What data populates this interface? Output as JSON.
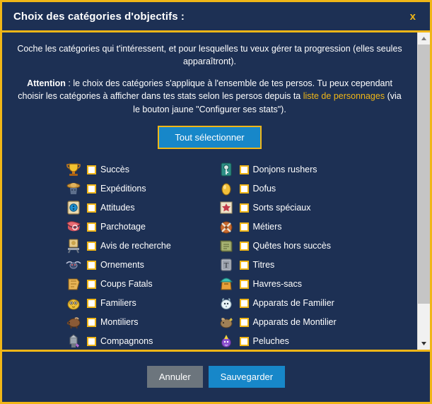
{
  "header": {
    "title": "Choix des catégories d'objectifs :",
    "close_label": "x"
  },
  "intro": {
    "line1": "Coche les catégories qui t'intéressent, et pour lesquelles tu veux gérer ta progression (elles seules apparaîtront).",
    "attention_label": "Attention",
    "line2_before": " : le choix des catégories s'applique à l'ensemble de tes persos. Tu peux cependant choisir les catégories à afficher dans tes stats selon les persos depuis ta ",
    "link_text": "liste de personnages",
    "line2_after": " (via le bouton jaune \"Configurer ses stats\")."
  },
  "select_all": {
    "label": "Tout sélectionner"
  },
  "categories": {
    "left": [
      {
        "label": "Succès",
        "icon": "trophy-icon",
        "checked": false
      },
      {
        "label": "Expéditions",
        "icon": "explorer-icon",
        "checked": false
      },
      {
        "label": "Attitudes",
        "icon": "scroll-blue-icon",
        "checked": false
      },
      {
        "label": "Parchotage",
        "icon": "parchment-red-icon",
        "checked": false
      },
      {
        "label": "Avis de recherche",
        "icon": "wanted-poster-icon",
        "checked": false
      },
      {
        "label": "Ornements",
        "icon": "ornament-icon",
        "checked": false
      },
      {
        "label": "Coups Fatals",
        "icon": "fatal-blow-icon",
        "checked": false
      },
      {
        "label": "Familiers",
        "icon": "pet-icon",
        "checked": false
      },
      {
        "label": "Montiliers",
        "icon": "mount-icon",
        "checked": false
      },
      {
        "label": "Compagnons",
        "icon": "companion-icon",
        "checked": false
      }
    ],
    "right": [
      {
        "label": "Donjons rushers",
        "icon": "dungeon-key-icon",
        "checked": false
      },
      {
        "label": "Dofus",
        "icon": "dofus-egg-icon",
        "checked": false
      },
      {
        "label": "Sorts spéciaux",
        "icon": "spell-scroll-icon",
        "checked": false
      },
      {
        "label": "Métiers",
        "icon": "profession-icon",
        "checked": false
      },
      {
        "label": "Quêtes hors succès",
        "icon": "quest-book-icon",
        "checked": false
      },
      {
        "label": "Titres",
        "icon": "title-t-icon",
        "checked": false
      },
      {
        "label": "Havres-sacs",
        "icon": "haven-bag-icon",
        "checked": false
      },
      {
        "label": "Apparats de Familier",
        "icon": "pet-skin-icon",
        "checked": false
      },
      {
        "label": "Apparats de Montilier",
        "icon": "mount-skin-icon",
        "checked": false
      },
      {
        "label": "Peluches",
        "icon": "plush-icon",
        "checked": false
      }
    ],
    "expander_label": "+"
  },
  "footer": {
    "cancel_label": "Annuler",
    "save_label": "Sauvegarder"
  },
  "colors": {
    "gold": "#f0b617",
    "panel": "#1d3054",
    "blue_button": "#1787c9",
    "gray_button": "#6c757d",
    "text": "#ffffff"
  }
}
